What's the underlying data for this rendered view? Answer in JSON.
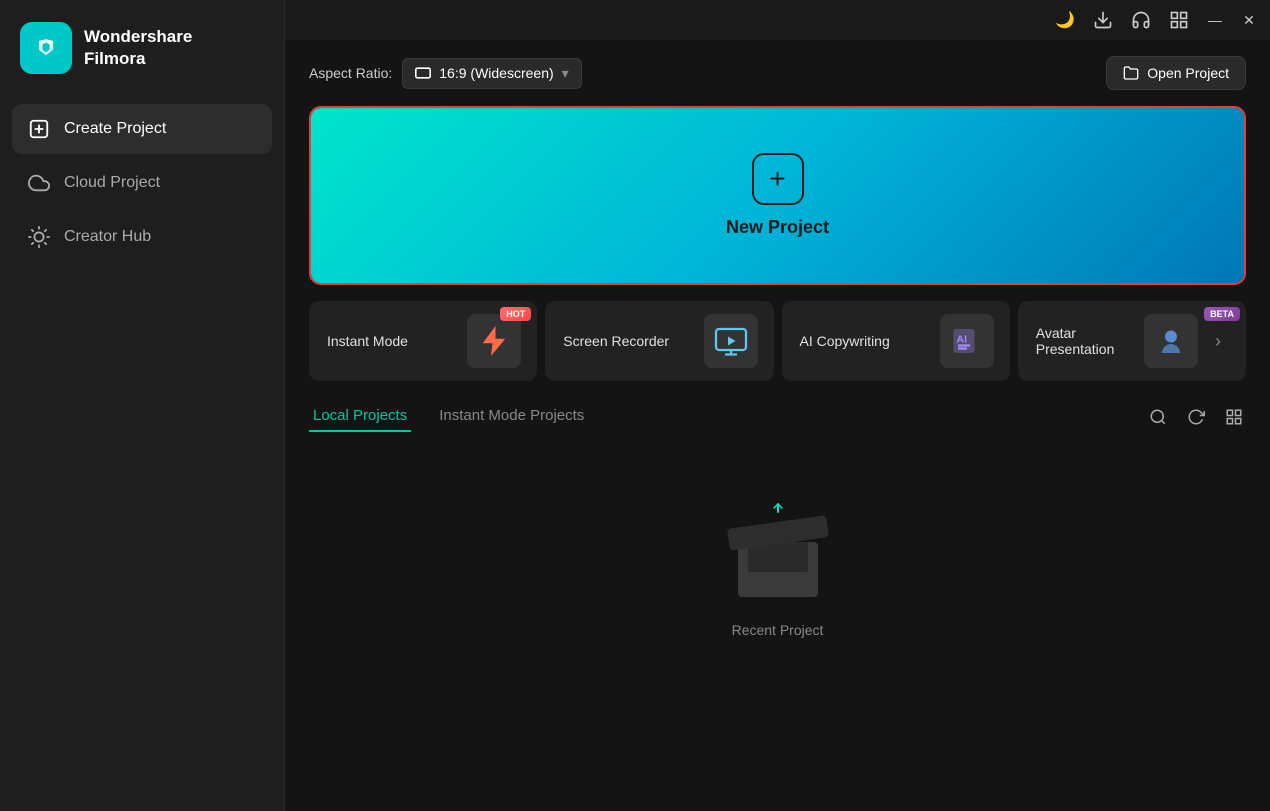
{
  "app": {
    "name": "Wondershare",
    "name2": "Filmora"
  },
  "titlebar": {
    "icons": [
      "notification",
      "download",
      "headset",
      "grid",
      "minimize",
      "close"
    ]
  },
  "sidebar": {
    "items": [
      {
        "id": "create-project",
        "label": "Create Project",
        "icon": "plus-square",
        "active": true
      },
      {
        "id": "cloud-project",
        "label": "Cloud Project",
        "icon": "cloud",
        "active": false
      },
      {
        "id": "creator-hub",
        "label": "Creator Hub",
        "icon": "lightbulb",
        "active": false
      }
    ]
  },
  "toolbar": {
    "aspect_label": "Aspect Ratio:",
    "aspect_value": "16:9 (Widescreen)",
    "open_project_label": "Open Project"
  },
  "new_project": {
    "label": "New Project"
  },
  "quick_cards": [
    {
      "id": "instant-mode",
      "label": "Instant Mode",
      "badge": "HOT",
      "badge_type": "hot"
    },
    {
      "id": "screen-recorder",
      "label": "Screen Recorder",
      "badge": null
    },
    {
      "id": "ai-copywriting",
      "label": "AI Copywriting",
      "badge": null
    },
    {
      "id": "avatar-presentation",
      "label": "Avatar Presentation",
      "badge": "BETA",
      "badge_type": "beta"
    }
  ],
  "tabs": [
    {
      "id": "local-projects",
      "label": "Local Projects",
      "active": true
    },
    {
      "id": "instant-mode-projects",
      "label": "Instant Mode Projects",
      "active": false
    }
  ],
  "empty_state": {
    "label": "Recent Project"
  }
}
